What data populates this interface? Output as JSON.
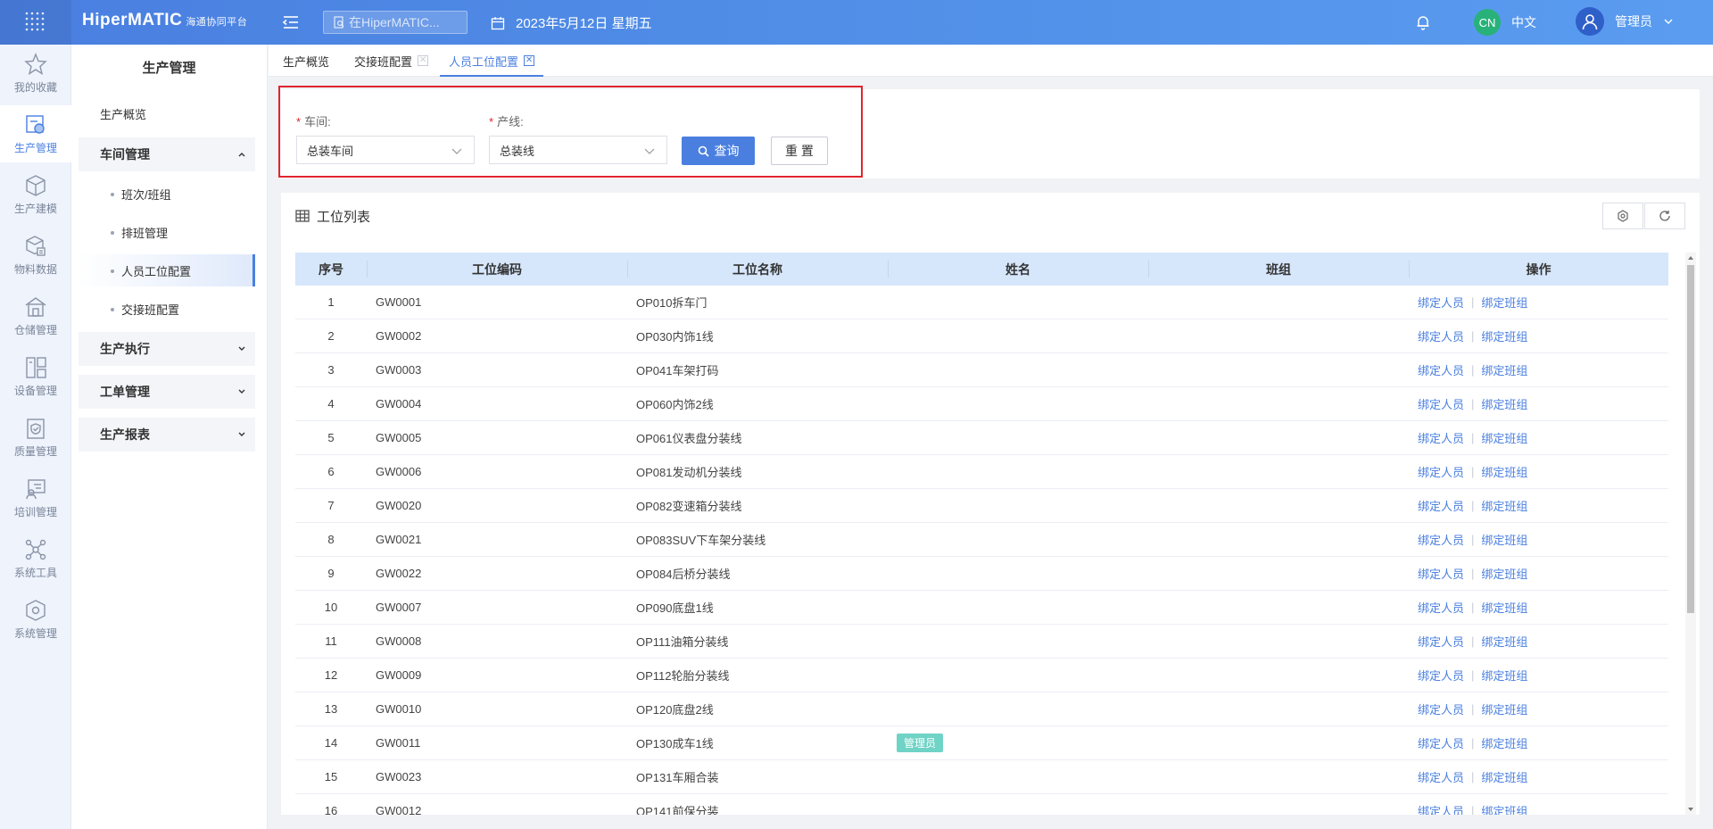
{
  "app": {
    "logo": "HiperMATIC",
    "logo_sub": "海通协同平台",
    "search_placeholder": "在HiperMATIC...",
    "date": "2023年5月12日 星期五",
    "lang_badge": "CN",
    "lang": "中文",
    "user": "管理员"
  },
  "rail": [
    {
      "label": "我的收藏",
      "icon": "star-icon"
    },
    {
      "label": "生产管理",
      "icon": "production-icon"
    },
    {
      "label": "生产建模",
      "icon": "cube-icon"
    },
    {
      "label": "物料数据",
      "icon": "material-icon"
    },
    {
      "label": "仓储管理",
      "icon": "warehouse-icon"
    },
    {
      "label": "设备管理",
      "icon": "device-icon"
    },
    {
      "label": "质量管理",
      "icon": "quality-icon"
    },
    {
      "label": "培训管理",
      "icon": "training-icon"
    },
    {
      "label": "系统工具",
      "icon": "network-icon"
    },
    {
      "label": "系统管理",
      "icon": "settings-cube-icon"
    }
  ],
  "sidebar": {
    "title": "生产管理",
    "overview": "生产概览",
    "groups": [
      {
        "label": "车间管理"
      },
      {
        "label": "生产执行"
      },
      {
        "label": "工单管理"
      },
      {
        "label": "生产报表"
      }
    ],
    "subs": [
      "班次/班组",
      "排班管理",
      "人员工位配置",
      "交接班配置"
    ]
  },
  "tabs": [
    "生产概览",
    "交接班配置",
    "人员工位配置"
  ],
  "filter": {
    "workshop_label": "车间:",
    "workshop_value": "总装车间",
    "line_label": "产线:",
    "line_value": "总装线",
    "query": "查询",
    "reset": "重 置"
  },
  "table": {
    "title": "工位列表",
    "headers": [
      "序号",
      "工位编码",
      "工位名称",
      "姓名",
      "班组",
      "操作"
    ],
    "action_bind_person": "绑定人员",
    "action_bind_team": "绑定班组",
    "action_sep": "|",
    "rows": [
      {
        "no": "1",
        "code": "GW0001",
        "name": "OP010拆车门",
        "person": "",
        "team": ""
      },
      {
        "no": "2",
        "code": "GW0002",
        "name": "OP030内饰1线",
        "person": "",
        "team": ""
      },
      {
        "no": "3",
        "code": "GW0003",
        "name": "OP041车架打码",
        "person": "",
        "team": ""
      },
      {
        "no": "4",
        "code": "GW0004",
        "name": "OP060内饰2线",
        "person": "",
        "team": ""
      },
      {
        "no": "5",
        "code": "GW0005",
        "name": "OP061仪表盘分装线",
        "person": "",
        "team": ""
      },
      {
        "no": "6",
        "code": "GW0006",
        "name": "OP081发动机分装线",
        "person": "",
        "team": ""
      },
      {
        "no": "7",
        "code": "GW0020",
        "name": "OP082变速箱分装线",
        "person": "",
        "team": ""
      },
      {
        "no": "8",
        "code": "GW0021",
        "name": "OP083SUV下车架分装线",
        "person": "",
        "team": ""
      },
      {
        "no": "9",
        "code": "GW0022",
        "name": "OP084后桥分装线",
        "person": "",
        "team": ""
      },
      {
        "no": "10",
        "code": "GW0007",
        "name": "OP090底盘1线",
        "person": "",
        "team": ""
      },
      {
        "no": "11",
        "code": "GW0008",
        "name": "OP111油箱分装线",
        "person": "",
        "team": ""
      },
      {
        "no": "12",
        "code": "GW0009",
        "name": "OP112轮胎分装线",
        "person": "",
        "team": ""
      },
      {
        "no": "13",
        "code": "GW0010",
        "name": "OP120底盘2线",
        "person": "",
        "team": ""
      },
      {
        "no": "14",
        "code": "GW0011",
        "name": "OP130成车1线",
        "person": "管理员",
        "team": ""
      },
      {
        "no": "15",
        "code": "GW0023",
        "name": "OP131车厢合装",
        "person": "",
        "team": ""
      },
      {
        "no": "16",
        "code": "GW0012",
        "name": "OP141前保分装",
        "person": "",
        "team": ""
      }
    ]
  },
  "colors": {
    "primary": "#4a7fe0",
    "highlight_border": "#e0242f",
    "tag": "#6fd3c6"
  }
}
